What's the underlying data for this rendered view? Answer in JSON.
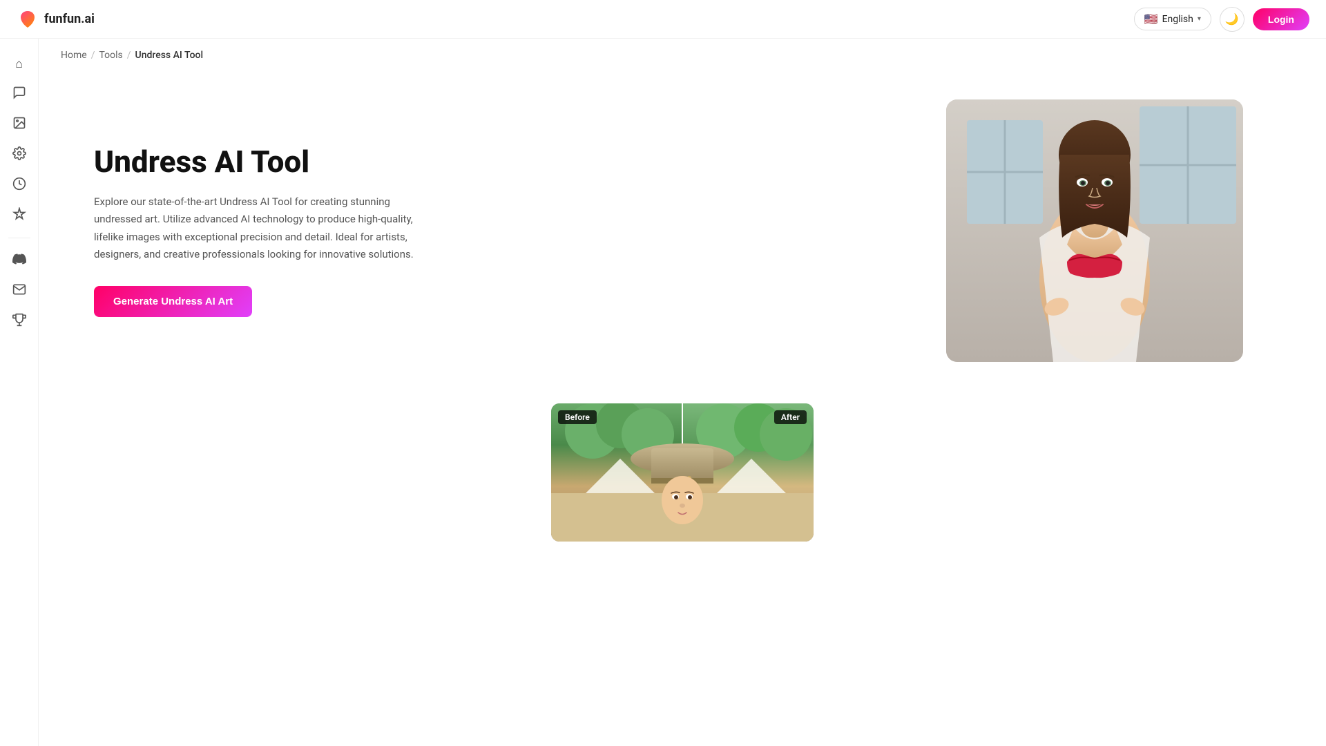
{
  "brand": {
    "name": "funfun.ai",
    "logo_emoji": "🍑"
  },
  "nav": {
    "lang_flag": "🇺🇸",
    "lang_label": "English",
    "theme_icon": "🌙",
    "login_label": "Login"
  },
  "breadcrumb": {
    "home": "Home",
    "tools": "Tools",
    "current": "Undress AI Tool"
  },
  "sidebar": {
    "items": [
      {
        "id": "home",
        "icon": "⌂",
        "label": "Home"
      },
      {
        "id": "chat",
        "icon": "💬",
        "label": "Chat"
      },
      {
        "id": "image",
        "icon": "🖼",
        "label": "Image"
      },
      {
        "id": "settings",
        "icon": "⚙",
        "label": "Settings"
      },
      {
        "id": "activity",
        "icon": "🎯",
        "label": "Activity"
      },
      {
        "id": "magic",
        "icon": "✨",
        "label": "Magic"
      },
      {
        "id": "discord",
        "icon": "🎮",
        "label": "Discord"
      },
      {
        "id": "mail",
        "icon": "✉",
        "label": "Mail"
      },
      {
        "id": "trophy",
        "icon": "🏆",
        "label": "Trophy"
      }
    ]
  },
  "hero": {
    "title": "Undress AI Tool",
    "description": "Explore our state-of-the-art Undress AI Tool for creating stunning undressed art. Utilize advanced AI technology to produce high-quality, lifelike images with exceptional precision and detail. Ideal for artists, designers, and creative professionals looking for innovative solutions.",
    "cta_label": "Generate Undress AI Art"
  },
  "before_after": {
    "before_label": "Before",
    "after_label": "After"
  }
}
